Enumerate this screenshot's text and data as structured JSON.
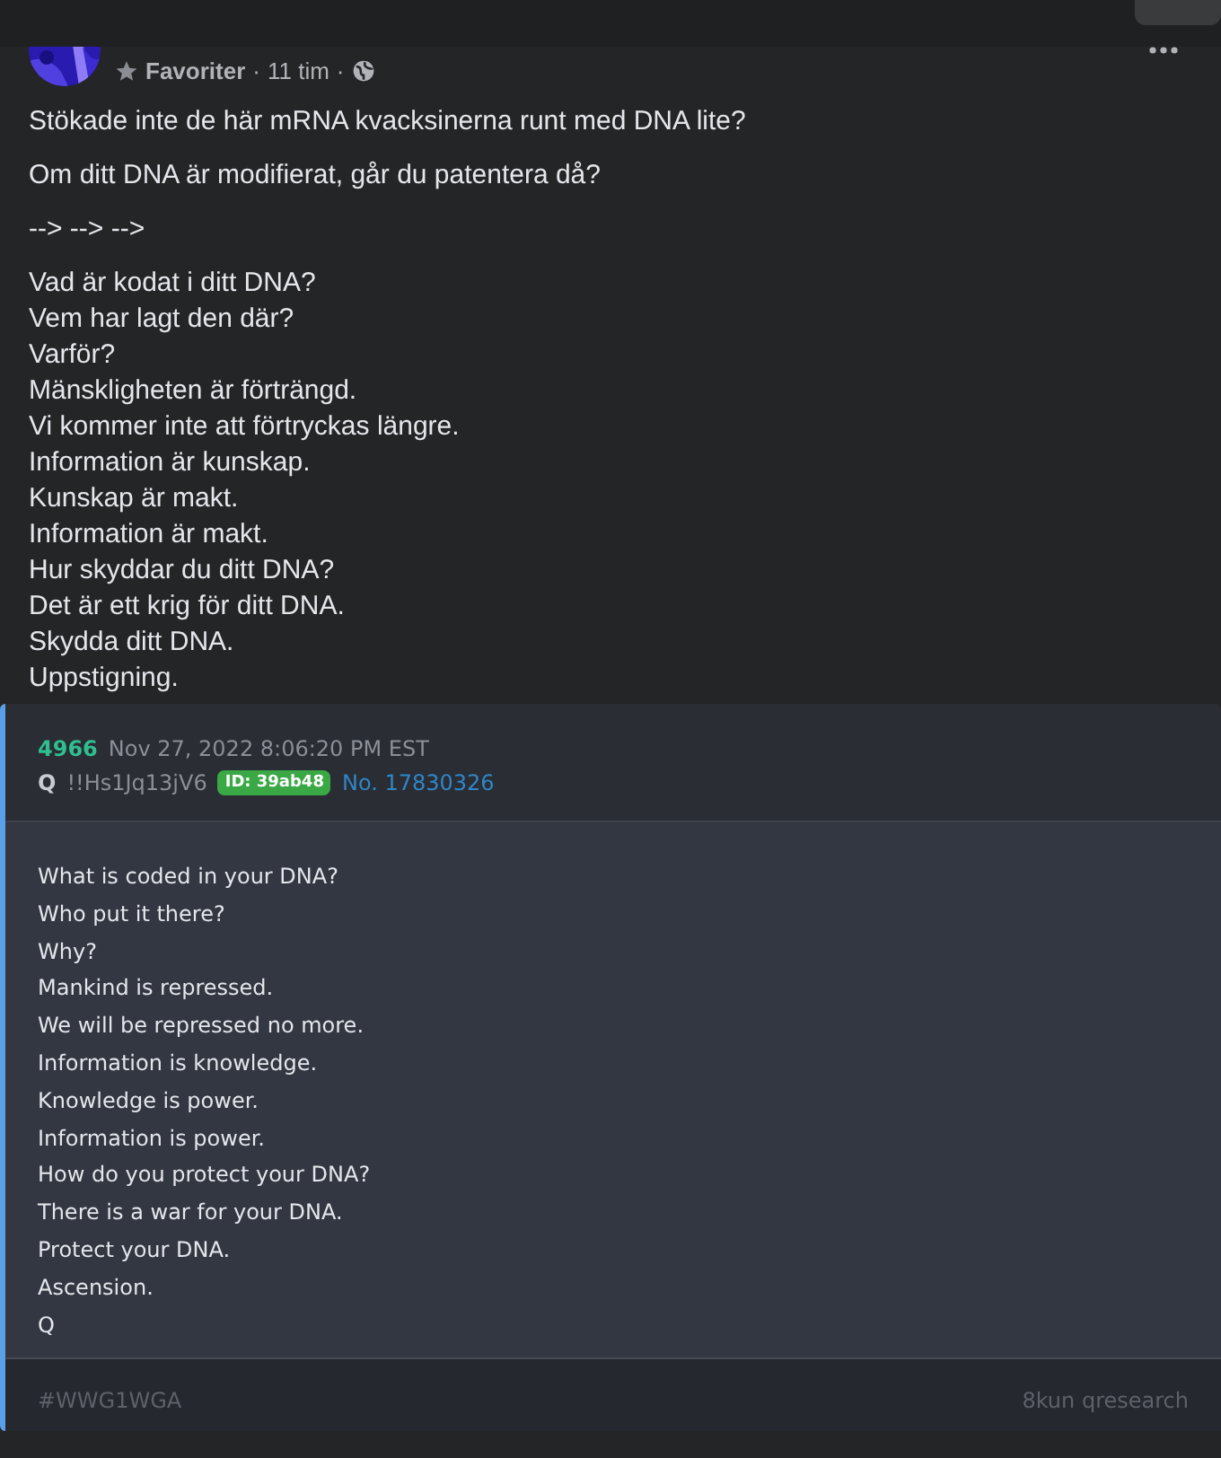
{
  "post": {
    "audience": "Favoriter",
    "separator_1": "·",
    "time": "11 tim",
    "separator_2": "·",
    "paragraphs": [
      "Stökade inte de här mRNA kvacksinerna runt med DNA lite?",
      "Om ditt DNA är modifierat, går du patentera då?",
      "--> --> -->"
    ],
    "lines": [
      "Vad är kodat i ditt DNA?",
      "Vem har lagt den där?",
      "Varför?",
      "Mänskligheten är förträngd.",
      "Vi kommer inte att förtryckas längre.",
      "Information är kunskap.",
      "Kunskap är makt.",
      "Information är makt.",
      "Hur skyddar du ditt DNA?",
      "Det är ett krig för ditt DNA.",
      "Skydda ditt DNA.",
      "Uppstigning."
    ]
  },
  "card": {
    "number": "4966",
    "date": "Nov 27, 2022 8:06:20 PM EST",
    "author": "Q",
    "tripcode": "!!Hs1Jq13jV6",
    "id_badge": "ID: 39ab48",
    "post_no": "No. 17830326",
    "lines": [
      "What is coded in your DNA?",
      "Who put it there?",
      "Why?",
      "Mankind is repressed.",
      "We will be repressed no more.",
      "Information is knowledge.",
      "Knowledge is power.",
      "Information is power.",
      "How do you protect your DNA?",
      "There is a war for your DNA.",
      "Protect your DNA.",
      "Ascension.",
      "Q"
    ],
    "hashtag": "#WWG1WGA",
    "source": "8kun qresearch"
  }
}
